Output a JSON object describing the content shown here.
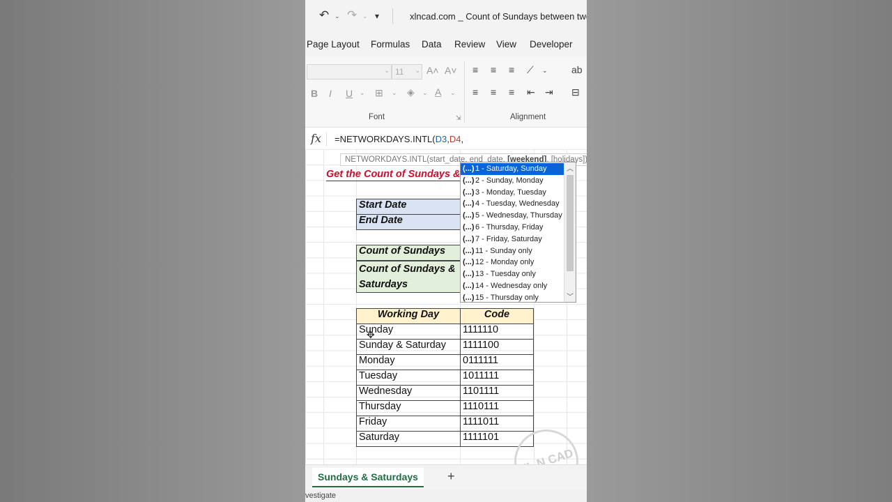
{
  "window": {
    "title": "xlncad.com _ Count of Sundays between two da",
    "icons": [
      "undo-icon",
      "redo-icon",
      "customize-qat-icon"
    ]
  },
  "ribbon_tabs": [
    "Page Layout",
    "Formulas",
    "Data",
    "Review",
    "View",
    "Developer"
  ],
  "ribbon": {
    "font_size": "11",
    "font_group_label": "Font",
    "alignment_group_label": "Alignment",
    "bold": "B",
    "italic": "I",
    "underline": "U"
  },
  "formula_bar": {
    "fx": "fx",
    "prefix": "=NETWORKDAYS.INTL(",
    "ref1": "D3",
    "comma1": ",",
    "ref2": "D4",
    "comma2": ","
  },
  "tooltip": {
    "text_start": "NETWORKDAYS.INTL(start_date, end_date, ",
    "bold_arg": "[weekend]",
    "text_end": ", [holidays])"
  },
  "sheet": {
    "title": "Get the Count of Sundays &",
    "labels": {
      "start_date": "Start Date",
      "end_date": "End Date",
      "count_sundays": "Count of Sundays",
      "count_sundays_saturdays_1": "Count of Sundays &",
      "count_sundays_saturdays_2": "Saturdays"
    },
    "table_headers": {
      "day": "Working Day",
      "code": "Code"
    },
    "rows": [
      {
        "day": "Sunday",
        "code": "1111110"
      },
      {
        "day": "Sunday & Saturday",
        "code": "1111100"
      },
      {
        "day": "Monday",
        "code": "0111111"
      },
      {
        "day": "Tuesday",
        "code": "1011111"
      },
      {
        "day": "Wednesday",
        "code": "1101111"
      },
      {
        "day": "Thursday",
        "code": "1110111"
      },
      {
        "day": "Friday",
        "code": "1111011"
      },
      {
        "day": "Saturday",
        "code": "1111101"
      }
    ]
  },
  "autocomplete": {
    "prefix": "(...)",
    "items": [
      "1 - Saturday, Sunday",
      "2 - Sunday, Monday",
      "3 - Monday, Tuesday",
      "4 - Tuesday, Wednesday",
      "5 - Wednesday, Thursday",
      "6 - Thursday, Friday",
      "7 - Friday, Saturday",
      "11 - Sunday only",
      "12 - Monday only",
      "13 - Tuesday only",
      "14 - Wednesday only",
      "15 - Thursday only"
    ],
    "selected_index": 0
  },
  "watermark": "XL N CAD",
  "sheet_tabs": {
    "active": "Sundays & Saturdays",
    "add": "+"
  },
  "status_bar": {
    "text": "vestigate"
  }
}
